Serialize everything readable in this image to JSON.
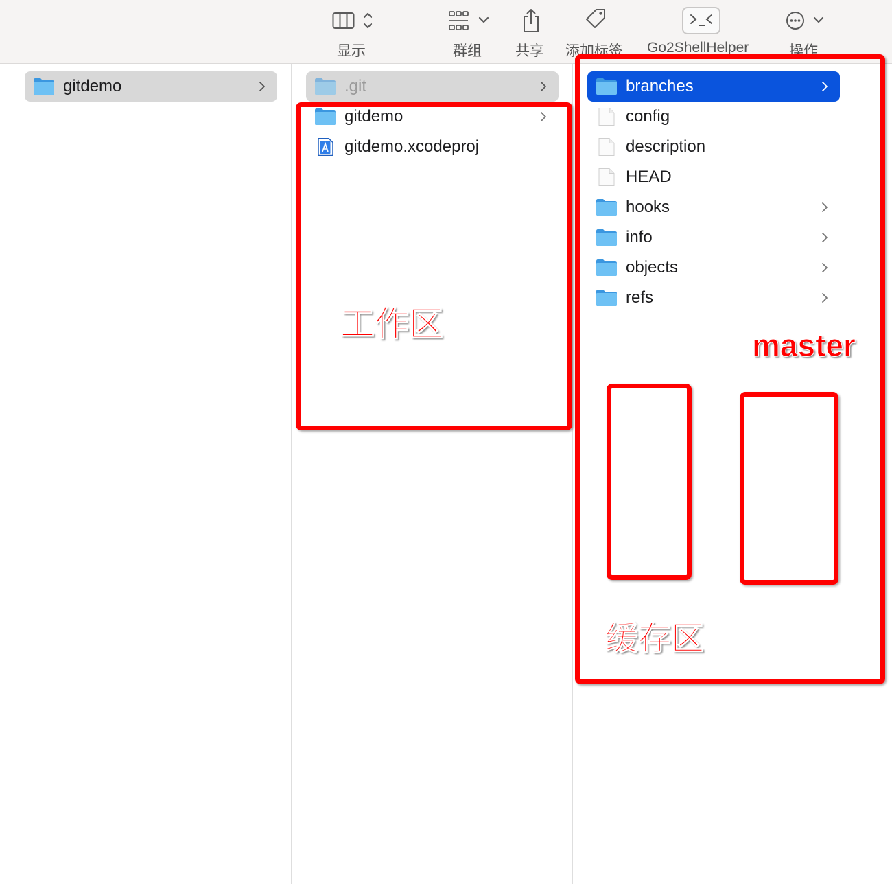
{
  "toolbar": {
    "view": {
      "label": "显示",
      "icon": "columns-view-icon"
    },
    "group": {
      "label": "群组",
      "icon": "group-grid-icon"
    },
    "share": {
      "label": "共享",
      "icon": "share-icon"
    },
    "tags": {
      "label": "添加标签",
      "icon": "tag-icon"
    },
    "go2shell": {
      "label": "Go2ShellHelper",
      "icon": "terminal-icon"
    },
    "actions": {
      "label": "操作",
      "icon": "more-ellipsis-icon"
    }
  },
  "columns": {
    "col1": {
      "items": [
        {
          "name": "gitdemo",
          "icon": "folder-icon",
          "has_children": true
        }
      ]
    },
    "col2": {
      "items": [
        {
          "name": ".git",
          "icon": "folder-icon",
          "has_children": true
        },
        {
          "name": "gitdemo",
          "icon": "folder-icon",
          "has_children": true
        },
        {
          "name": "gitdemo.xcodeproj",
          "icon": "xcode-project-icon",
          "has_children": false
        }
      ]
    },
    "col3": {
      "items": [
        {
          "name": "branches",
          "icon": "folder-icon",
          "has_children": true
        },
        {
          "name": "config",
          "icon": "file-icon",
          "has_children": false
        },
        {
          "name": "description",
          "icon": "file-icon",
          "has_children": false
        },
        {
          "name": "HEAD",
          "icon": "file-icon",
          "has_children": false
        },
        {
          "name": "hooks",
          "icon": "folder-icon",
          "has_children": true
        },
        {
          "name": "info",
          "icon": "folder-icon",
          "has_children": true
        },
        {
          "name": "objects",
          "icon": "folder-icon",
          "has_children": true
        },
        {
          "name": "refs",
          "icon": "folder-icon",
          "has_children": true
        }
      ]
    }
  },
  "annotations": {
    "workspace": "工作区",
    "master": "master",
    "staging": "缓存区"
  },
  "colors": {
    "selection_blue": "#0a54dd",
    "annotation_red": "#ff0000",
    "folder_blue": "#4aa8ea"
  }
}
